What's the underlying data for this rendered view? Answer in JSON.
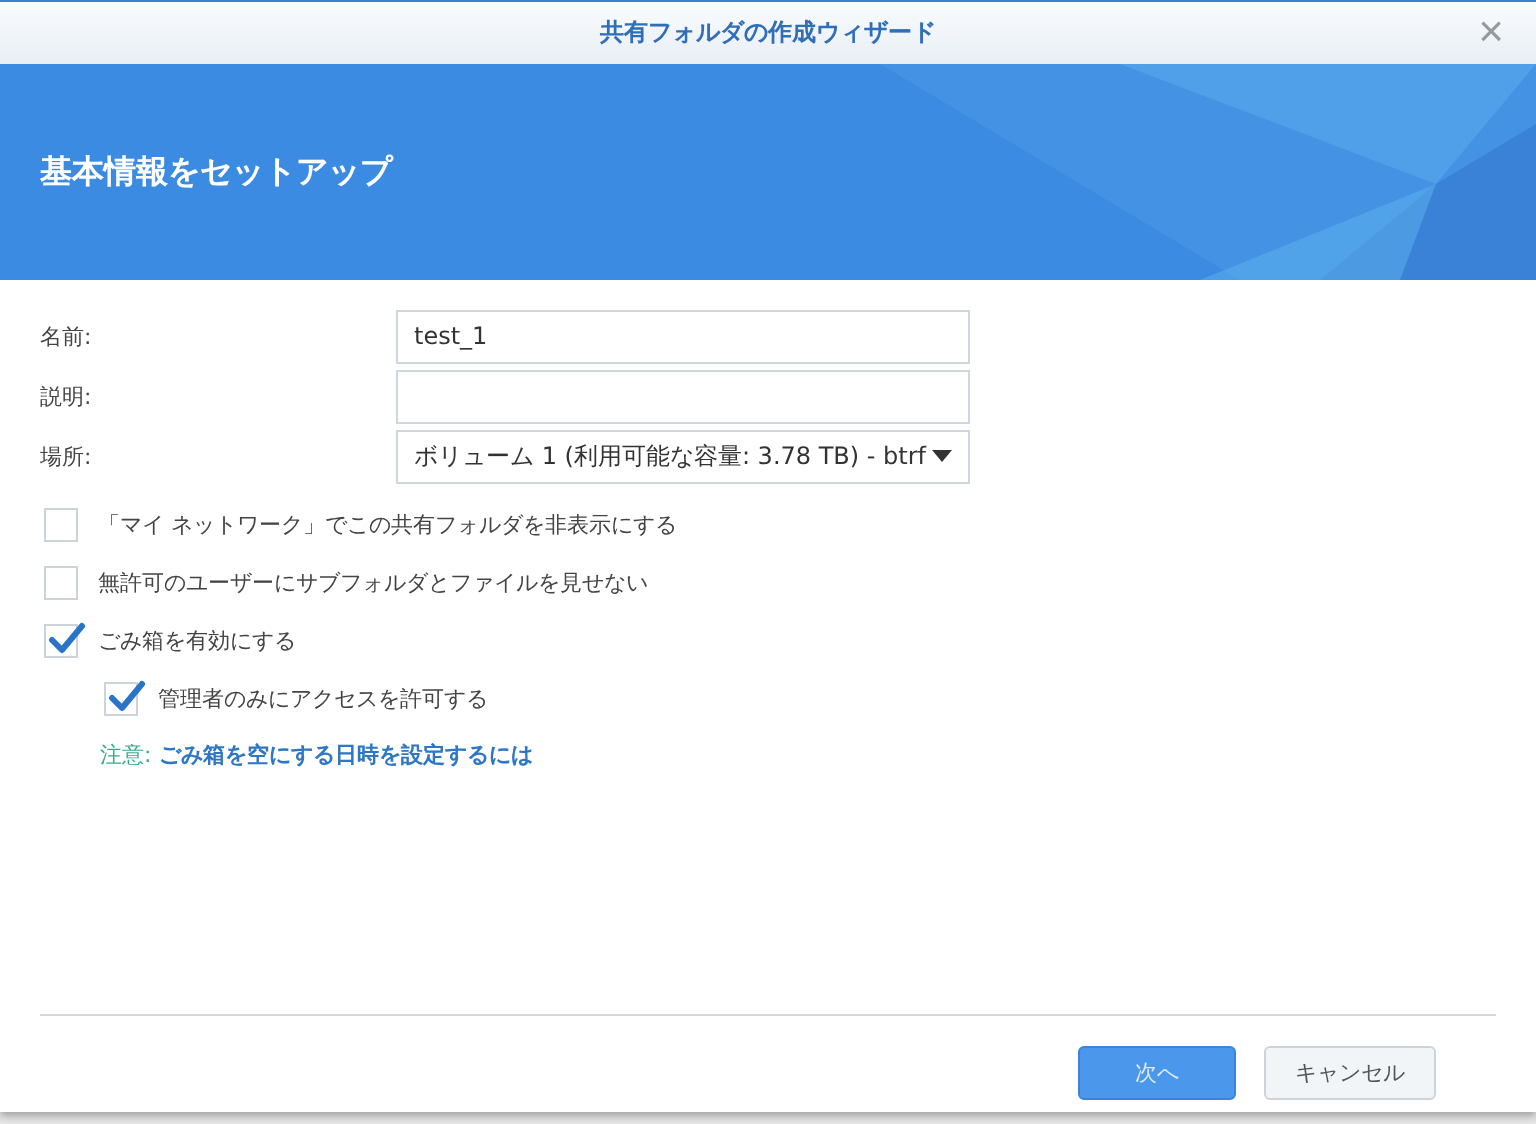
{
  "window": {
    "title": "共有フォルダの作成ウィザード",
    "close": "×"
  },
  "banner": {
    "title": "基本情報をセットアップ"
  },
  "fields": [
    {
      "label": "名前:",
      "kind": "text",
      "value": "test_1"
    },
    {
      "label": "説明:",
      "kind": "text"
    },
    {
      "label": "場所:",
      "kind": "select",
      "value": "ボリューム 1 (利用可能な容量: 3.78 TB) - btrf"
    }
  ],
  "options": [
    {
      "label": "「マイ ネットワーク」でこの共有フォルダを非表示にする",
      "checked": false
    },
    {
      "label": "無許可のユーザーにサブフォルダとファイルを見せない",
      "checked": false
    },
    {
      "label": "ごみ箱を有効にする",
      "checked": true,
      "children": [
        {
          "label": "管理者のみにアクセスを許可する",
          "checked": true
        }
      ]
    }
  ],
  "note": {
    "prefix": "注意:",
    "link": "ごみ箱を空にする日時を設定するには"
  },
  "buttons": [
    {
      "label": "次へ",
      "kind": "primary"
    },
    {
      "label": "キャンセル",
      "kind": "secondary"
    }
  ]
}
